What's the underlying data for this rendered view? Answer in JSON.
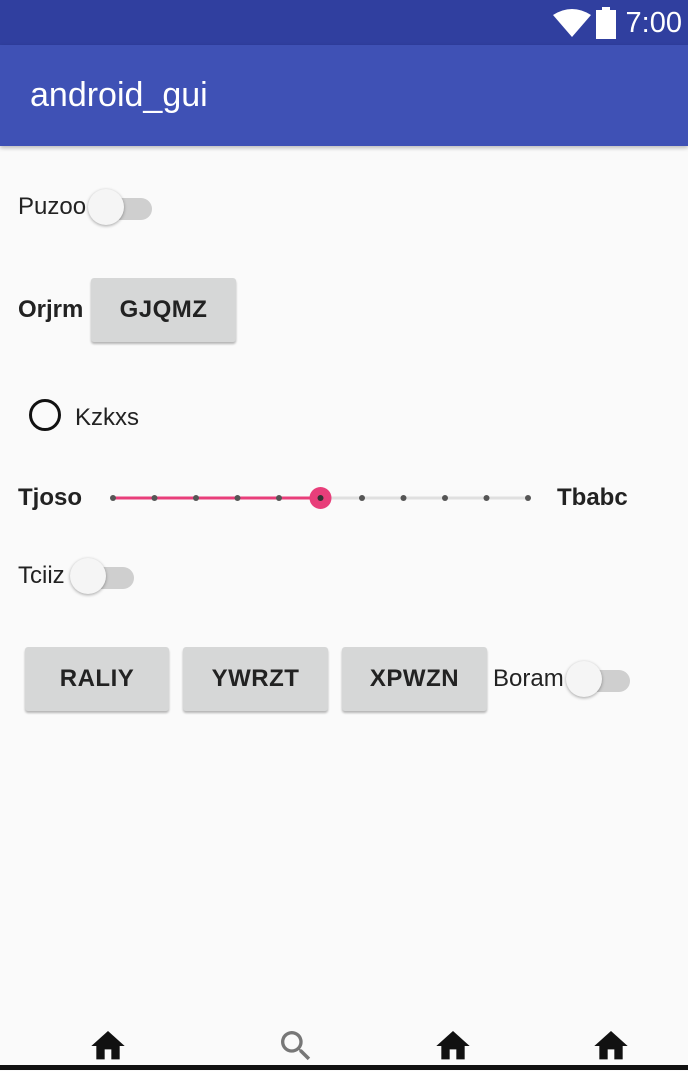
{
  "status_bar": {
    "time": "7:00",
    "icons": [
      "wifi-icon",
      "battery-icon"
    ]
  },
  "app_bar": {
    "title": "android_gui"
  },
  "rows": {
    "puzoo": {
      "label": "Puzoo",
      "switch_on": false
    },
    "orjrm": {
      "label": "Orjrm",
      "button": "GJQMZ"
    },
    "kzkxs": {
      "label": "Kzkxs",
      "checked": false
    },
    "slider": {
      "start_label": "Tjoso",
      "end_label": "Tbabc",
      "steps": 10,
      "value": 5,
      "accent": "#e83e7a"
    },
    "tciiz": {
      "label": "Tciiz",
      "switch_on": false
    },
    "buttons": [
      "RALIY",
      "YWRZT",
      "XPWZN"
    ],
    "boram": {
      "label": "Boram",
      "switch_on": false
    }
  },
  "bottom_nav": {
    "items": [
      "home-icon",
      "search-icon",
      "home-icon",
      "home-icon"
    ]
  },
  "colors": {
    "status_bar": "#303f9f",
    "app_bar": "#3f51b5",
    "accent": "#e83e7a"
  }
}
